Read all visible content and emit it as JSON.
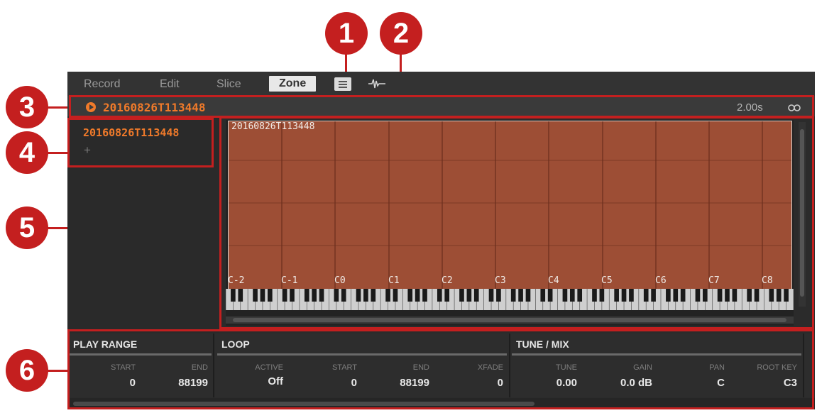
{
  "markers": [
    "1",
    "2",
    "3",
    "4",
    "5",
    "6"
  ],
  "tabs": [
    "Record",
    "Edit",
    "Slice",
    "Zone"
  ],
  "active_tab": "Zone",
  "icons": {
    "menu": "list-menu-icon",
    "waveform": "waveform-icon",
    "play": "play-icon",
    "link": "link-icon",
    "add": "plus-icon"
  },
  "header": {
    "sample_name": "20160826T113448",
    "duration": "2.00s"
  },
  "zone_list": {
    "items": [
      "20160826T113448"
    ],
    "add_label": "+"
  },
  "zone_map": {
    "zone_label": "20160826T113448",
    "notes": [
      "C-2",
      "C-1",
      "C0",
      "C1",
      "C2",
      "C3",
      "C4",
      "C5",
      "C6",
      "C7",
      "C8"
    ]
  },
  "params": {
    "play_range": {
      "title": "PLAY RANGE",
      "start_label": "START",
      "start": "0",
      "end_label": "END",
      "end": "88199"
    },
    "loop": {
      "title": "LOOP",
      "active_label": "ACTIVE",
      "active": "Off",
      "start_label": "START",
      "start": "0",
      "end_label": "END",
      "end": "88199",
      "xfade_label": "XFADE",
      "xfade": "0"
    },
    "tune_mix": {
      "title": "TUNE / MIX",
      "tune_label": "TUNE",
      "tune": "0.00",
      "gain_label": "GAIN",
      "gain": "0.0 dB",
      "pan_label": "PAN",
      "pan": "C",
      "rootkey_label": "ROOT KEY",
      "rootkey": "C3"
    }
  },
  "colors": {
    "accent": "#f07a2a",
    "callout": "#c41f1f",
    "zone_fill": "#9d4e35",
    "panel": "#2b2b2b"
  }
}
